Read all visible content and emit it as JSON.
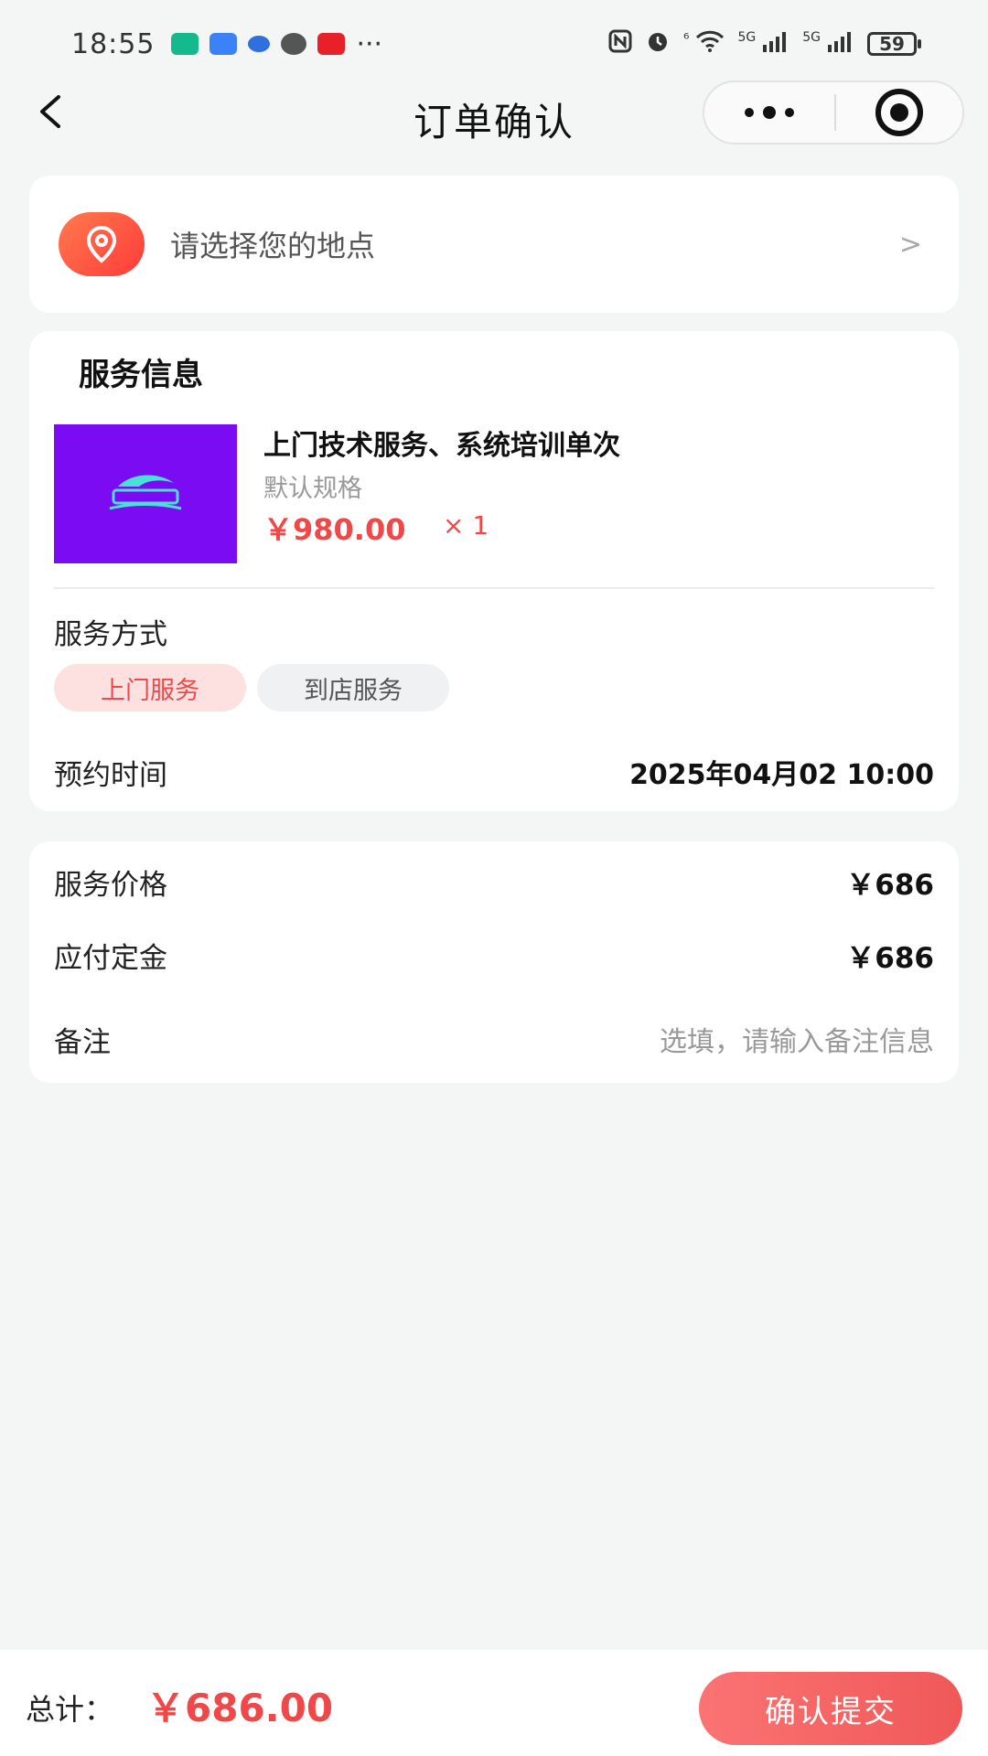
{
  "status_bar": {
    "time": "18:55",
    "ellipsis": "···",
    "network_1": "⁶",
    "network_2": "5G",
    "network_3": "5G",
    "battery": "59"
  },
  "nav": {
    "title": "订单确认"
  },
  "location": {
    "placeholder": "请选择您的地点",
    "chevron": ">"
  },
  "service": {
    "section_title": "服务信息",
    "product": {
      "name": "上门技术服务、系统培训单次",
      "spec": "默认规格",
      "price": "￥980.00",
      "quantity": "× 1",
      "image_color": "#7a0bf2"
    },
    "method_label": "服务方式",
    "methods": [
      {
        "label": "上门服务",
        "selected": true
      },
      {
        "label": "到店服务",
        "selected": false
      }
    ],
    "time_label": "预约时间",
    "time_value": "2025年04月02 10:00"
  },
  "pricing": {
    "service_price_label": "服务价格",
    "service_price_value": "￥686",
    "deposit_label": "应付定金",
    "deposit_value": "￥686",
    "remark_label": "备注",
    "remark_placeholder": "选填，请输入备注信息"
  },
  "footer": {
    "total_label": "总计：",
    "total_value": "￥686.00",
    "submit_label": "确认提交"
  },
  "colors": {
    "accent": "#f04848",
    "chip_active_bg": "#fde1e1",
    "background": "#f4f5f5"
  }
}
